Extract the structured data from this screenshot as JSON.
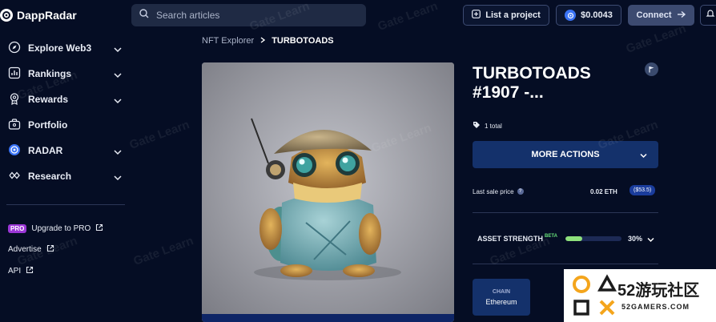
{
  "brand": {
    "name": "DappRadar"
  },
  "header": {
    "search_placeholder": "Search articles",
    "list_project_label": "List a project",
    "radar_price": "$0.0043",
    "connect_label": "Connect"
  },
  "sidebar": {
    "items": [
      {
        "label": "Explore Web3",
        "icon": "compass-icon",
        "expandable": true
      },
      {
        "label": "Rankings",
        "icon": "bar-chart-icon",
        "expandable": true
      },
      {
        "label": "Rewards",
        "icon": "medal-icon",
        "expandable": true
      },
      {
        "label": "Portfolio",
        "icon": "briefcase-icon",
        "expandable": false
      },
      {
        "label": "RADAR",
        "icon": "radar-icon",
        "expandable": true
      },
      {
        "label": "Research",
        "icon": "research-icon",
        "expandable": true
      }
    ],
    "links": [
      {
        "badge": "PRO",
        "label": "Upgrade to PRO"
      },
      {
        "label": "Advertise"
      },
      {
        "label": "API"
      }
    ]
  },
  "breadcrumb": {
    "parent": "NFT Explorer",
    "current": "TURBOTOADS"
  },
  "nft": {
    "title": "TURBOTOADS #1907 -...",
    "total": "1 total",
    "more_actions_label": "MORE ACTIONS",
    "last_sale_label": "Last sale price",
    "last_sale_eth": "0.02 ETH",
    "last_sale_usd": "($53.5)",
    "asset_strength_label": "ASSET STRENGTH",
    "beta_label": "BETA",
    "asset_strength_pct": "30%",
    "asset_strength_value": 0.3,
    "chain_label": "CHAIN",
    "chain_value": "Ethereum"
  },
  "watermark": {
    "text": "Gate Learn"
  },
  "corner_logo": {
    "title": "52游玩社区",
    "subtitle": "52GAMERS.COM"
  },
  "colors": {
    "background": "#050d24",
    "accent_blue": "#14316b",
    "pro_purple": "#9b37d6",
    "strength_green": "#8ee07c"
  }
}
